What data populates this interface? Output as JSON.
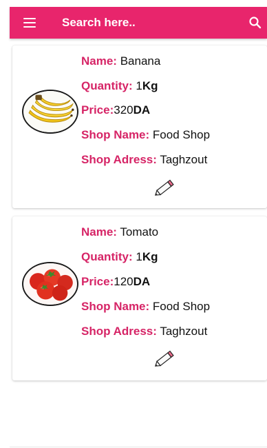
{
  "appbar": {
    "color": "#e8256c",
    "search_placeholder": "Search here..",
    "menu_icon": "hamburger-menu-icon",
    "search_icon": "magnifier-icon"
  },
  "labels": {
    "name": "Name:",
    "quantity": "Quantity:",
    "price": "Price:",
    "shop_name": "Shop Name:",
    "shop_address": "Shop Adress:"
  },
  "products": [
    {
      "name": "Banana",
      "quantity_value": "1",
      "quantity_unit": "Kg",
      "price_value": "320",
      "price_unit": "DA",
      "shop_name": "Food Shop",
      "shop_address": "Taghzout",
      "image": "banana-image"
    },
    {
      "name": "Tomato",
      "quantity_value": "1",
      "quantity_unit": "Kg",
      "price_value": "120",
      "price_unit": "DA",
      "shop_name": "Food Shop",
      "shop_address": "Taghzout",
      "image": "tomato-image"
    }
  ],
  "edit_icon": "pencil-icon",
  "label_color": "#d62466"
}
